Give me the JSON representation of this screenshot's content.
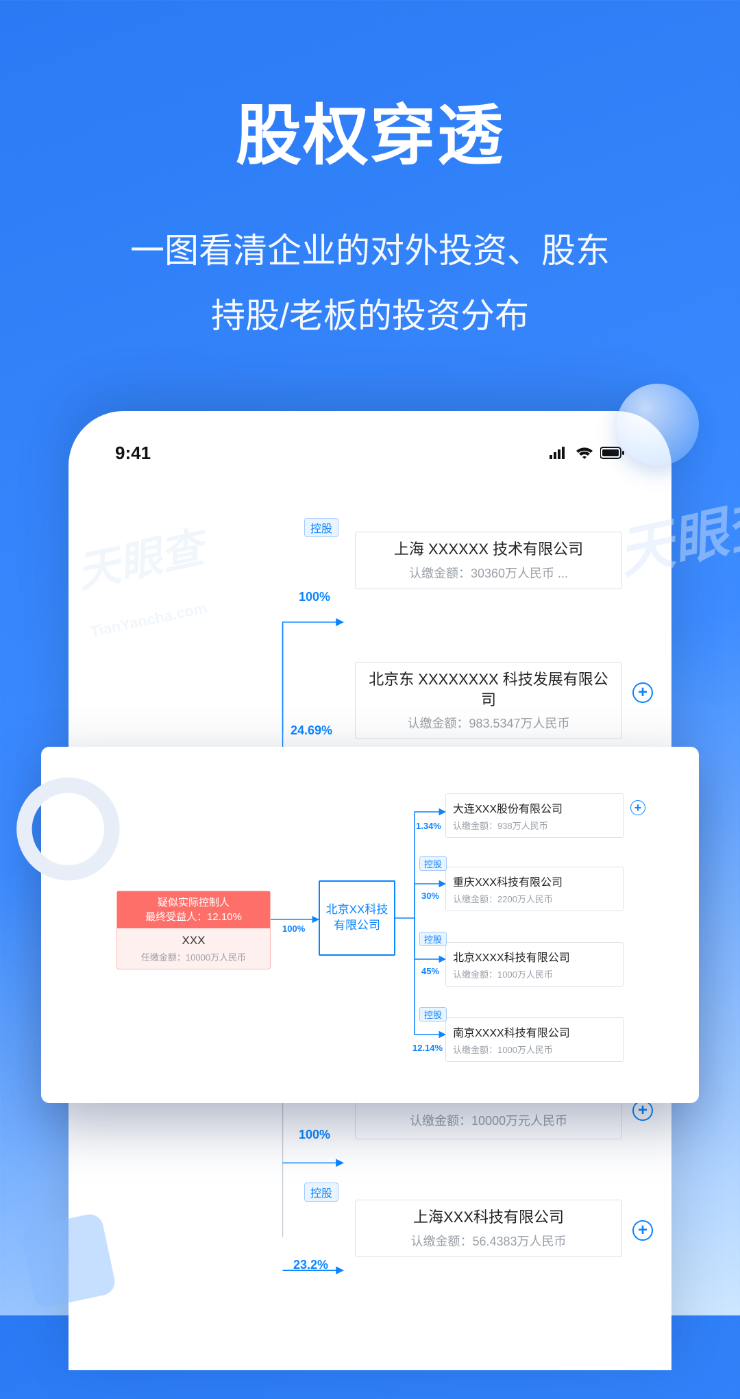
{
  "hero": {
    "title": "股权穿透",
    "sub1": "一图看清企业的对外投资、股东",
    "sub2": "持股/老板的投资分布"
  },
  "status": {
    "time": "9:41"
  },
  "watermark": {
    "brand": "天眼查",
    "domain": "TianYancha.com"
  },
  "tags": {
    "holding": "控股"
  },
  "phone_nodes": {
    "n1": {
      "name": "上海 XXXXXX 技术有限公司",
      "amt": "认缴金额：30360万人民币  ...",
      "pct": "100%"
    },
    "n2": {
      "name": "北京东 XXXXXXXX 科技发展有限公司",
      "amt": "认缴金额：983.5347万人民币",
      "pct": "24.69%"
    },
    "n3": {
      "amt": "认缴金额：10000万元人民币",
      "pct": "100%"
    },
    "n4": {
      "name": "上海XXX科技有限公司",
      "amt": "认缴金额：56.4383万人民币",
      "pct": "23.2%"
    }
  },
  "detail": {
    "root": {
      "badge1": "疑似实际控制人",
      "badge2": "最终受益人：12.10%",
      "name": "XXX",
      "amt": "任缴金额：10000万人民币",
      "link_pct": "100%"
    },
    "center": "北京XX科技有限公司",
    "children": [
      {
        "name": "大连XXX股份有限公司",
        "amt": "认缴金额：938万人民币",
        "pct": "1.34%",
        "holding": false,
        "plus": true
      },
      {
        "name": "重庆XXX科技有限公司",
        "amt": "认缴金额：2200万人民币",
        "pct": "30%",
        "holding": true,
        "plus": false
      },
      {
        "name": "北京XXXX科技有限公司",
        "amt": "认缴金额：1000万人民币",
        "pct": "45%",
        "holding": true,
        "plus": false
      },
      {
        "name": "南京XXXX科技有限公司",
        "amt": "认缴金额：1000万人民币",
        "pct": "12.14%",
        "holding": true,
        "plus": false
      }
    ]
  }
}
